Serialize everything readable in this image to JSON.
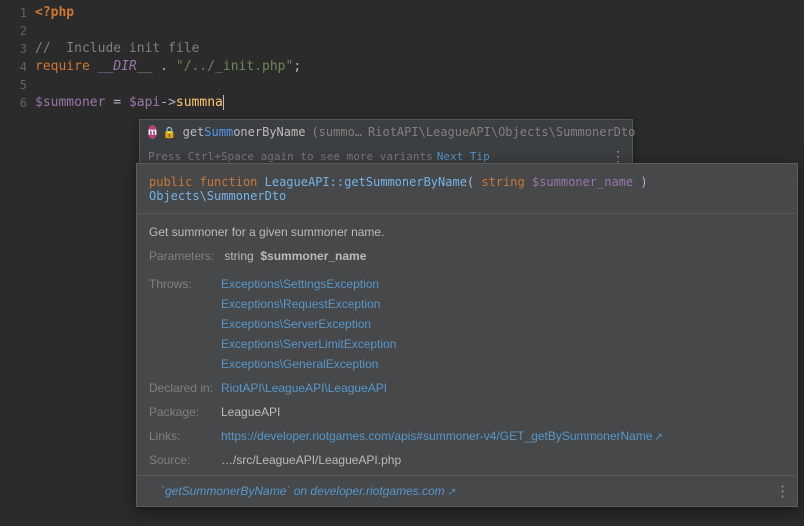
{
  "gutter": {
    "l1": "1",
    "l2": "2",
    "l3": "3",
    "l4": "4",
    "l5": "5",
    "l6": "6"
  },
  "code": {
    "phptag": "<?php",
    "comment": "//  Include init file",
    "require": "require",
    "dir": "__DIR__",
    "dot": " . ",
    "reqstr": "\"/../_init.php\"",
    "semi": ";",
    "var1": "$summoner",
    "eq": " = ",
    "var2": "$api",
    "arrow": "->",
    "call": "summna"
  },
  "popup1": {
    "m_icon": "m",
    "name_get": "get",
    "name_summ": "Summ",
    "name_suf": "onerByName",
    "args": "(summo…",
    "type": "RiotAPI\\LeagueAPI\\Objects\\SummonerDto",
    "hint": "Press Ctrl+Space again to see more variants",
    "next": "Next Tip",
    "dots": "⋮"
  },
  "popup2": {
    "kw_public": "public",
    "kw_function": "function",
    "sig_class": "LeagueAPI::getSummonerByName",
    "sig_strkw": "string",
    "sig_var": "$summoner_name",
    "sig_ret": "Objects\\SummonerDto",
    "desc": "Get summoner for a given summoner name.",
    "lbl_params": "Parameters:",
    "params_type": "string",
    "params_name": "$summoner_name",
    "lbl_throws": "Throws:",
    "throws": {
      "e1": "Exceptions\\SettingsException",
      "e2": "Exceptions\\RequestException",
      "e3": "Exceptions\\ServerException",
      "e4": "Exceptions\\ServerLimitException",
      "e5": "Exceptions\\GeneralException"
    },
    "lbl_declared": "Declared in:",
    "declared": "RiotAPI\\LeagueAPI\\LeagueAPI",
    "lbl_package": "Package:",
    "package": "LeagueAPI",
    "lbl_links": "Links:",
    "link": "https://developer.riotgames.com/apis#summoner-v4/GET_getBySummonerName",
    "lbl_source": "Source:",
    "source": "…/src/LeagueAPI/LeagueAPI.php",
    "foot": "`getSummonerByName` on developer.riotgames.com",
    "arrow": "↗",
    "dots": "⋮"
  }
}
